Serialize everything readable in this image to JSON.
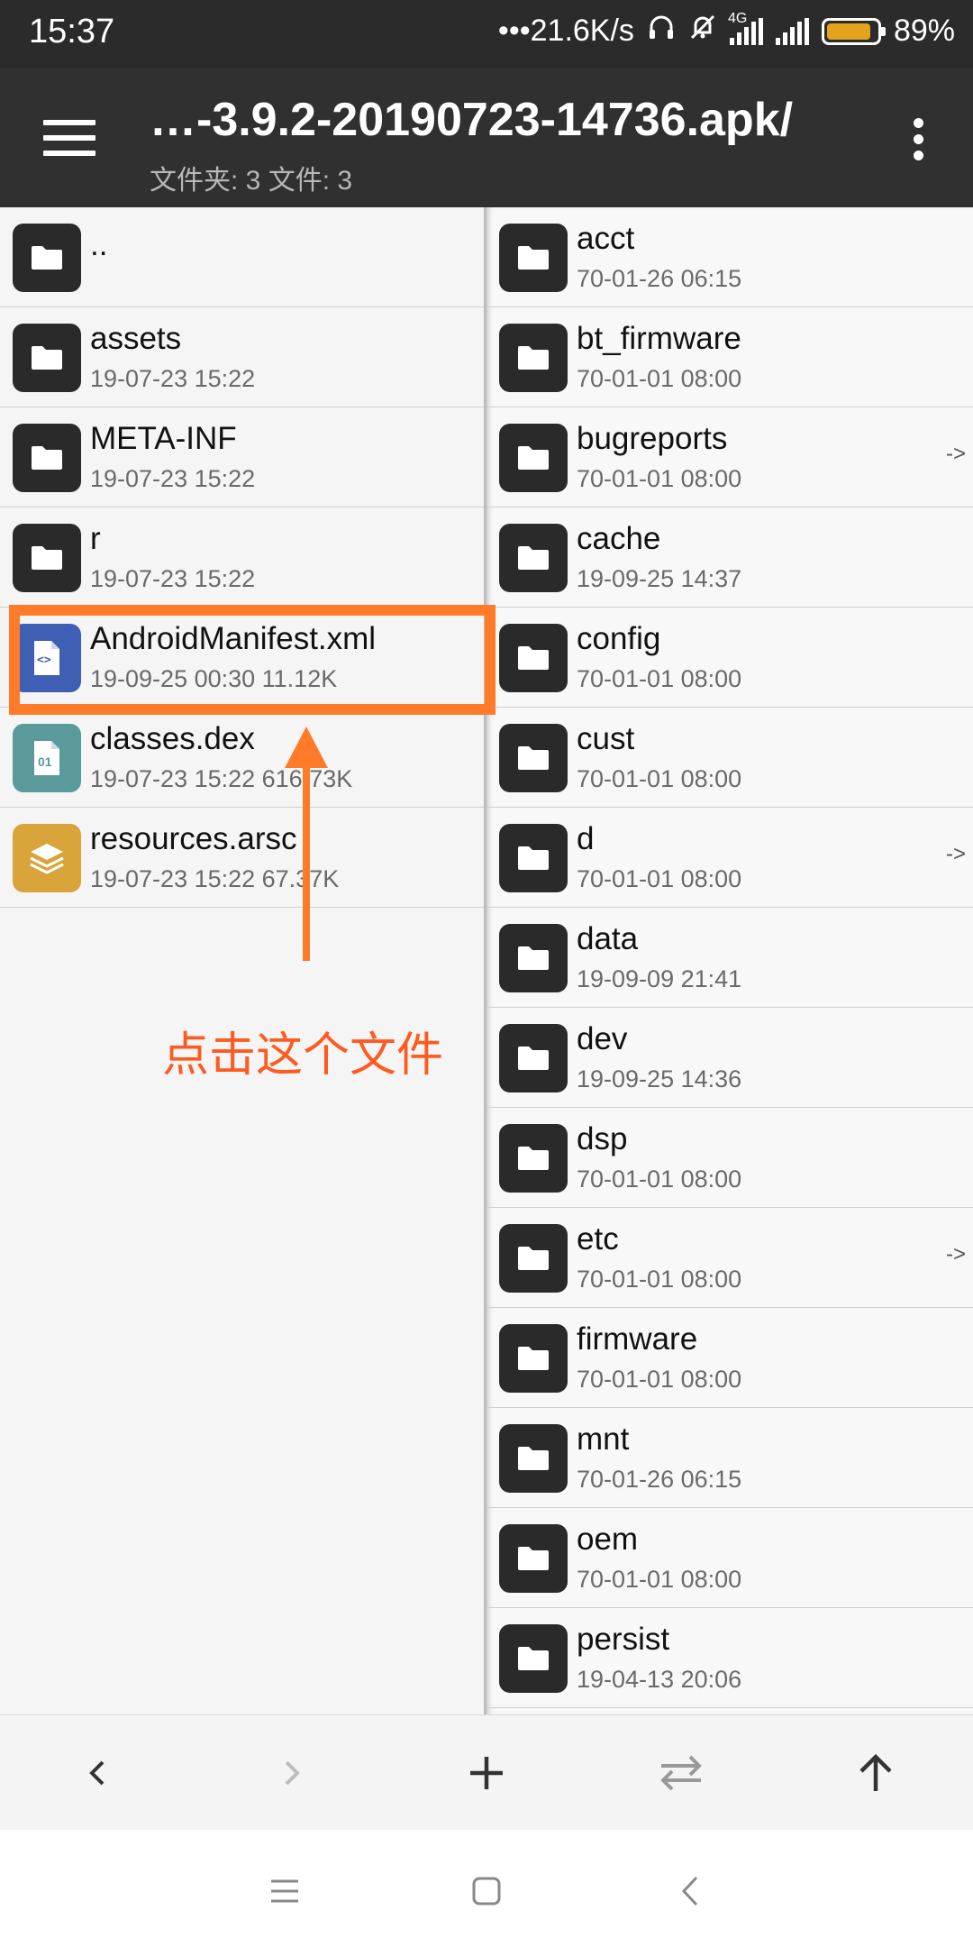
{
  "status_bar": {
    "time": "15:37",
    "net_speed": "•••21.6K/s",
    "network": "4G",
    "battery": "89%",
    "battery_level": 0.89,
    "accent": "#e3a41d"
  },
  "toolbar": {
    "title": "…-3.9.2-20190723-14736.apk/",
    "subtitle": "文件夹: 3  文件: 3",
    "menu_icon": "hamburger-icon",
    "more_icon": "overflow-icon"
  },
  "left_pane": {
    "items": [
      {
        "name": "..",
        "meta": "",
        "icon": "folder-icon"
      },
      {
        "name": "assets",
        "meta": "19-07-23 15:22",
        "icon": "folder-icon"
      },
      {
        "name": "META-INF",
        "meta": "19-07-23 15:22",
        "icon": "folder-icon"
      },
      {
        "name": "r",
        "meta": "19-07-23 15:22",
        "icon": "folder-icon"
      },
      {
        "name": "AndroidManifest.xml",
        "meta": "19-09-25 00:30  11.12K",
        "icon": "xml-file-icon",
        "color": "#3f5fb5"
      },
      {
        "name": "classes.dex",
        "meta": "19-07-23 15:22  616.73K",
        "icon": "dex-file-icon",
        "color": "#5a9a9a"
      },
      {
        "name": "resources.arsc",
        "meta": "19-07-23 15:22  67.37K",
        "icon": "layers-file-icon",
        "color": "#d9a43a"
      }
    ]
  },
  "right_pane": {
    "items": [
      {
        "name": "acct",
        "meta": "70-01-26 06:15",
        "link": ""
      },
      {
        "name": "bt_firmware",
        "meta": "70-01-01 08:00",
        "link": ""
      },
      {
        "name": "bugreports",
        "meta": "70-01-01 08:00",
        "link": "->"
      },
      {
        "name": "cache",
        "meta": "19-09-25 14:37",
        "link": ""
      },
      {
        "name": "config",
        "meta": "70-01-01 08:00",
        "link": ""
      },
      {
        "name": "cust",
        "meta": "70-01-01 08:00",
        "link": ""
      },
      {
        "name": "d",
        "meta": "70-01-01 08:00",
        "link": "->"
      },
      {
        "name": "data",
        "meta": "19-09-09 21:41",
        "link": ""
      },
      {
        "name": "dev",
        "meta": "19-09-25 14:36",
        "link": ""
      },
      {
        "name": "dsp",
        "meta": "70-01-01 08:00",
        "link": ""
      },
      {
        "name": "etc",
        "meta": "70-01-01 08:00",
        "link": "->"
      },
      {
        "name": "firmware",
        "meta": "70-01-01 08:00",
        "link": ""
      },
      {
        "name": "mnt",
        "meta": "70-01-26 06:15",
        "link": ""
      },
      {
        "name": "oem",
        "meta": "70-01-01 08:00",
        "link": ""
      },
      {
        "name": "persist",
        "meta": "19-04-13 20:06",
        "link": ""
      }
    ]
  },
  "annotation": {
    "text": "点击这个文件",
    "color": "#ff7b2a"
  },
  "action_bar": {
    "items": [
      "back-arrow-icon",
      "forward-arrow-icon",
      "plus-icon",
      "swap-icon",
      "up-arrow-icon"
    ]
  },
  "nav_bar": {
    "items": [
      "menu-icon",
      "home-icon",
      "back-icon"
    ]
  }
}
